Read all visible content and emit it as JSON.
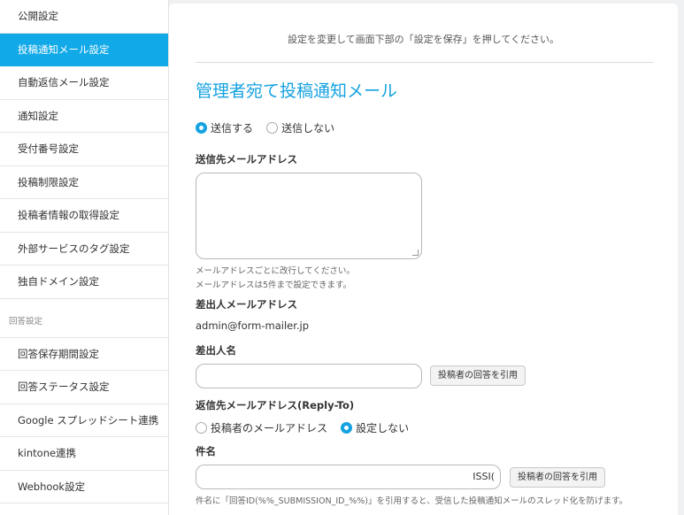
{
  "sidebar": {
    "items": [
      {
        "label": "公開設定"
      },
      {
        "label": "投稿通知メール設定",
        "active": true
      },
      {
        "label": "自動返信メール設定"
      },
      {
        "label": "通知設定"
      },
      {
        "label": "受付番号設定"
      },
      {
        "label": "投稿制限設定"
      },
      {
        "label": "投稿者情報の取得設定"
      },
      {
        "label": "外部サービスのタグ設定"
      },
      {
        "label": "独自ドメイン設定"
      }
    ],
    "section_label": "回答設定",
    "section_items": [
      {
        "label": "回答保存期間設定"
      },
      {
        "label": "回答ステータス設定"
      },
      {
        "label": "Google スプレッドシート連携"
      },
      {
        "label": "kintone連携"
      },
      {
        "label": "Webhook設定"
      }
    ]
  },
  "main": {
    "notice": "設定を変更して画面下部の「設定を保存」を押してください。",
    "title": "管理者宛て投稿通知メール",
    "send_options": [
      {
        "label": "送信する",
        "checked": true
      },
      {
        "label": "送信しない",
        "checked": false
      }
    ],
    "to_address": {
      "label": "送信先メールアドレス",
      "value": "",
      "help_1": "メールアドレスごとに改行してください。",
      "help_2": "メールアドレスは5件まで設定できます。"
    },
    "from_address": {
      "label": "差出人メールアドレス",
      "value": "admin@form-mailer.jp"
    },
    "from_name": {
      "label": "差出人名",
      "value": "",
      "button": "投稿者の回答を引用"
    },
    "reply_to": {
      "label": "返信先メールアドレス(Reply-To)",
      "options": [
        {
          "label": "投稿者のメールアドレス",
          "checked": false
        },
        {
          "label": "設定しない",
          "checked": true
        }
      ]
    },
    "subject": {
      "label": "件名",
      "value": "ISSI(",
      "button": "投稿者の回答を引用",
      "help": "件名に「回答ID(%%_SUBMISSION_ID_%%)」を引用すると、受信した投稿通知メールのスレッド化を防げます。"
    }
  },
  "colors": {
    "accent": "#11a9e8",
    "title": "#14a2e0"
  }
}
